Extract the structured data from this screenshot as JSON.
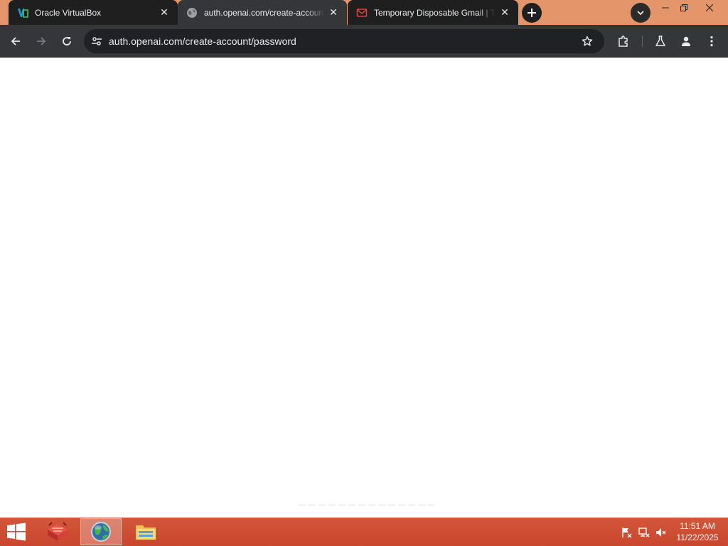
{
  "browser": {
    "tabs": [
      {
        "title": "Oracle VirtualBox",
        "favicon": "virtualbox-icon",
        "state": "inactive"
      },
      {
        "title": "auth.openai.com/create-account/password",
        "favicon": "globe-icon",
        "state": "active"
      },
      {
        "title": "Temporary Disposable Gmail | Temp Gmail",
        "favicon": "mail-icon",
        "state": "inactive"
      }
    ],
    "tab_close_glyph": "✕",
    "omnibox": {
      "url": "auth.openai.com/create-account/password"
    },
    "colors": {
      "titlebar": "#e5956a",
      "toolbar": "#35363a",
      "omnibox": "#202124"
    }
  },
  "page": {
    "background": "#ffffff",
    "state": "blank"
  },
  "taskbar": {
    "apps": [
      "start-button",
      "virtualbox-app",
      "chrome-app",
      "file-explorer-app"
    ],
    "clock": {
      "time": "11:51 AM",
      "date": "11/22/2025"
    },
    "color": "#c9472e"
  }
}
